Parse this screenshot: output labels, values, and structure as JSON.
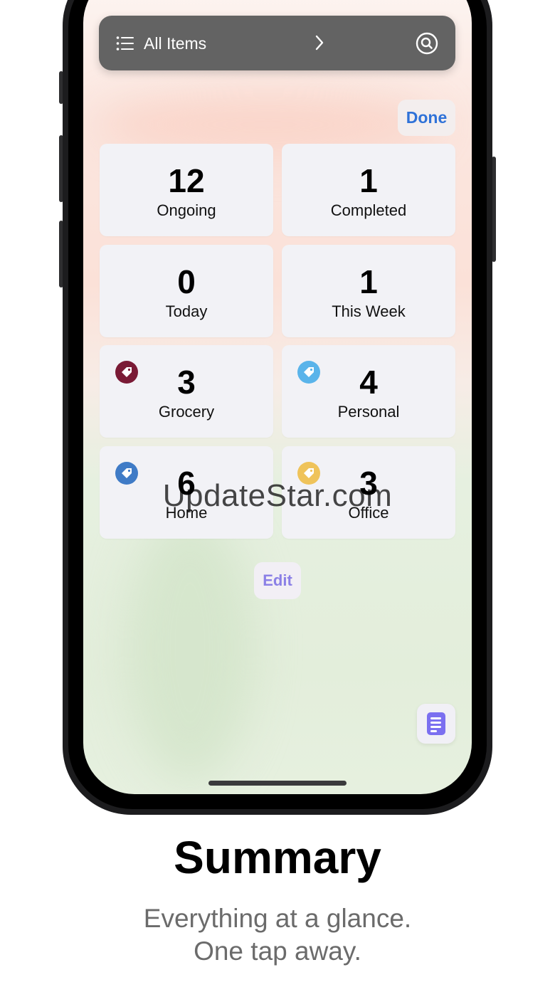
{
  "topbar": {
    "title": "All Items"
  },
  "actions": {
    "done_label": "Done",
    "edit_label": "Edit"
  },
  "summary_cards": [
    {
      "count": "12",
      "label": "Ongoing"
    },
    {
      "count": "1",
      "label": "Completed"
    },
    {
      "count": "0",
      "label": "Today"
    },
    {
      "count": "1",
      "label": "This Week"
    },
    {
      "count": "3",
      "label": "Grocery",
      "tag_color": "#7a1a35"
    },
    {
      "count": "4",
      "label": "Personal",
      "tag_color": "#5ab4ea"
    },
    {
      "count": "6",
      "label": "Home",
      "tag_color": "#3f7bc6"
    },
    {
      "count": "3",
      "label": "Office",
      "tag_color": "#efc35a"
    }
  ],
  "watermark": "UpdateStar.com",
  "caption": {
    "title": "Summary",
    "subtitle_line1": "Everything at a glance.",
    "subtitle_line2": "One tap away."
  },
  "icons": {
    "topbar_left": "list-icon",
    "topbar_chevron": "chevron-right-icon",
    "topbar_right": "search-icon",
    "tag": "tag-icon",
    "fab": "document-icon"
  },
  "colors": {
    "accent_blue": "#2f72d8",
    "edit_purple": "#8b80e6",
    "topbar_gray": "#636363"
  }
}
